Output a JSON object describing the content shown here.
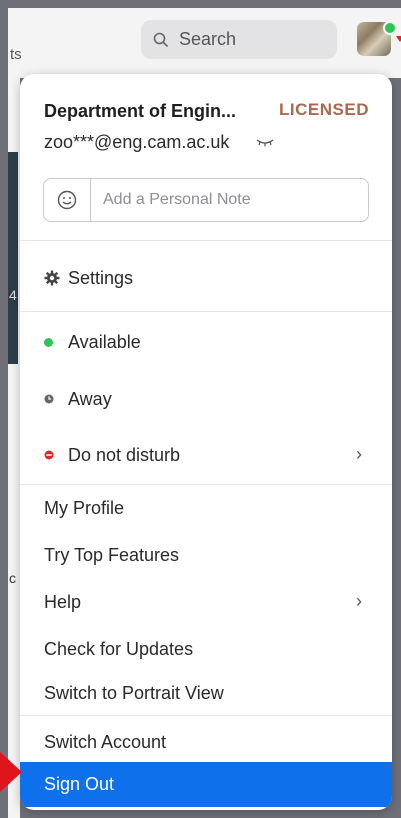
{
  "background": {
    "left_text": "ts",
    "side_char_1": "4",
    "side_char_2": "c"
  },
  "search": {
    "label": "Search"
  },
  "profile": {
    "name": "Department of Engin...",
    "license": "LICENSED",
    "email": "zoo***@eng.cam.ac.uk",
    "note_placeholder": "Add a Personal Note",
    "status_color": "#2fc458"
  },
  "menu": {
    "settings": "Settings",
    "available": "Available",
    "away": "Away",
    "dnd": "Do not disturb",
    "my_profile": "My Profile",
    "try_top_features": "Try Top Features",
    "help": "Help",
    "check_updates": "Check for Updates",
    "portrait_view": "Switch to Portrait View",
    "switch_account": "Switch Account",
    "sign_out": "Sign Out"
  },
  "colors": {
    "accent": "#0e71eb",
    "available": "#2fc458",
    "away": "#666666",
    "dnd": "#e02828",
    "license": "#a86a4f",
    "arrow": "#e0141c"
  }
}
